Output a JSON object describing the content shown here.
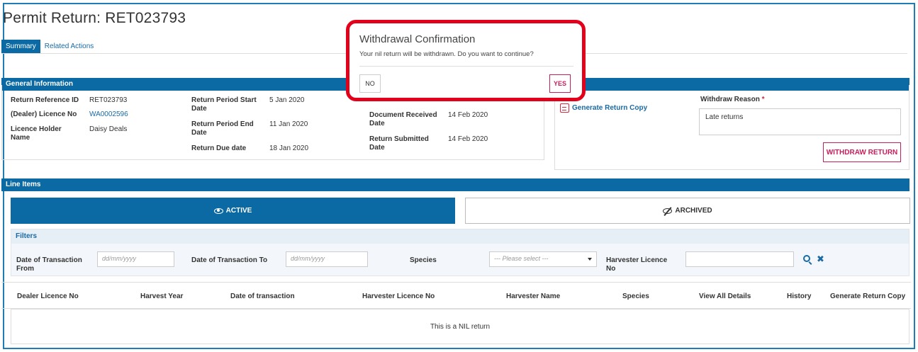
{
  "page": {
    "title": "Permit Return: RET023793",
    "tabs": [
      {
        "label": "Summary",
        "active": true
      },
      {
        "label": "Related Actions",
        "active": false
      }
    ]
  },
  "general_info": {
    "header": "General Information",
    "col1": [
      {
        "label": "Return Reference ID",
        "value": "RET023793"
      },
      {
        "label": "(Dealer) Licence No",
        "value": "WA0002596"
      },
      {
        "label": "Licence Holder Name",
        "value": "Daisy Deals"
      }
    ],
    "col2": [
      {
        "label": "Return Period Start Date",
        "value": "5 Jan 2020"
      },
      {
        "label": "Return Period End Date",
        "value": "11 Jan 2020"
      },
      {
        "label": "Return Due date",
        "value": "18 Jan 2020"
      }
    ],
    "col3": [
      {
        "label": "Document Received Date",
        "value": "14 Feb 2020"
      },
      {
        "label": "Return Submitted Date",
        "value": "14 Feb 2020"
      }
    ]
  },
  "actions": {
    "generate_copy": "Generate Return Copy",
    "withdraw_reason_label": "Withdraw Reason",
    "required_mark": "*",
    "withdraw_reason_value": "Late returns",
    "withdraw_button": "WITHDRAW RETURN"
  },
  "line_items": {
    "header": "Line Items",
    "active_label": "ACTIVE",
    "archived_label": "ARCHIVED"
  },
  "filters": {
    "header": "Filters",
    "date_from_label": "Date of Transaction From",
    "date_to_label": "Date of Transaction To",
    "species_label": "Species",
    "harvester_label": "Harvester Licence No",
    "date_placeholder": "dd/mm/yyyy",
    "species_placeholder": "--- Please select ---"
  },
  "table": {
    "columns": [
      "Dealer Licence No",
      "Harvest Year",
      "Date of transaction",
      "Harvester Licence No",
      "Harvester Name",
      "Species",
      "View All Details",
      "History",
      "Generate Return Copy"
    ],
    "empty_message": "This is a NIL return"
  },
  "modal": {
    "title": "Withdrawal Confirmation",
    "message": "Your nil return will be withdrawn. Do you want to continue?",
    "no_label": "NO",
    "yes_label": "YES",
    "highlight_color": "#e3001b"
  },
  "colors": {
    "primary": "#0b6aa3",
    "accent": "#c81e5b"
  }
}
